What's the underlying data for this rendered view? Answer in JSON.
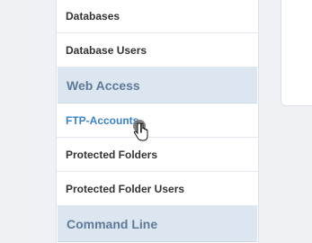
{
  "sidebar": {
    "items": [
      {
        "label": "Databases"
      },
      {
        "label": "Database Users"
      }
    ],
    "sections": [
      {
        "title": "Web Access",
        "items": [
          {
            "label": "FTP-Accounts",
            "active": true
          },
          {
            "label": "Protected Folders"
          },
          {
            "label": "Protected Folder Users"
          }
        ]
      },
      {
        "title": "Command Line"
      }
    ]
  },
  "colors": {
    "accent": "#3b82c4",
    "section_bg": "#dce6f1",
    "section_text": "#5f7a98"
  },
  "icons": {
    "cursor": "hand-pointer-icon"
  }
}
